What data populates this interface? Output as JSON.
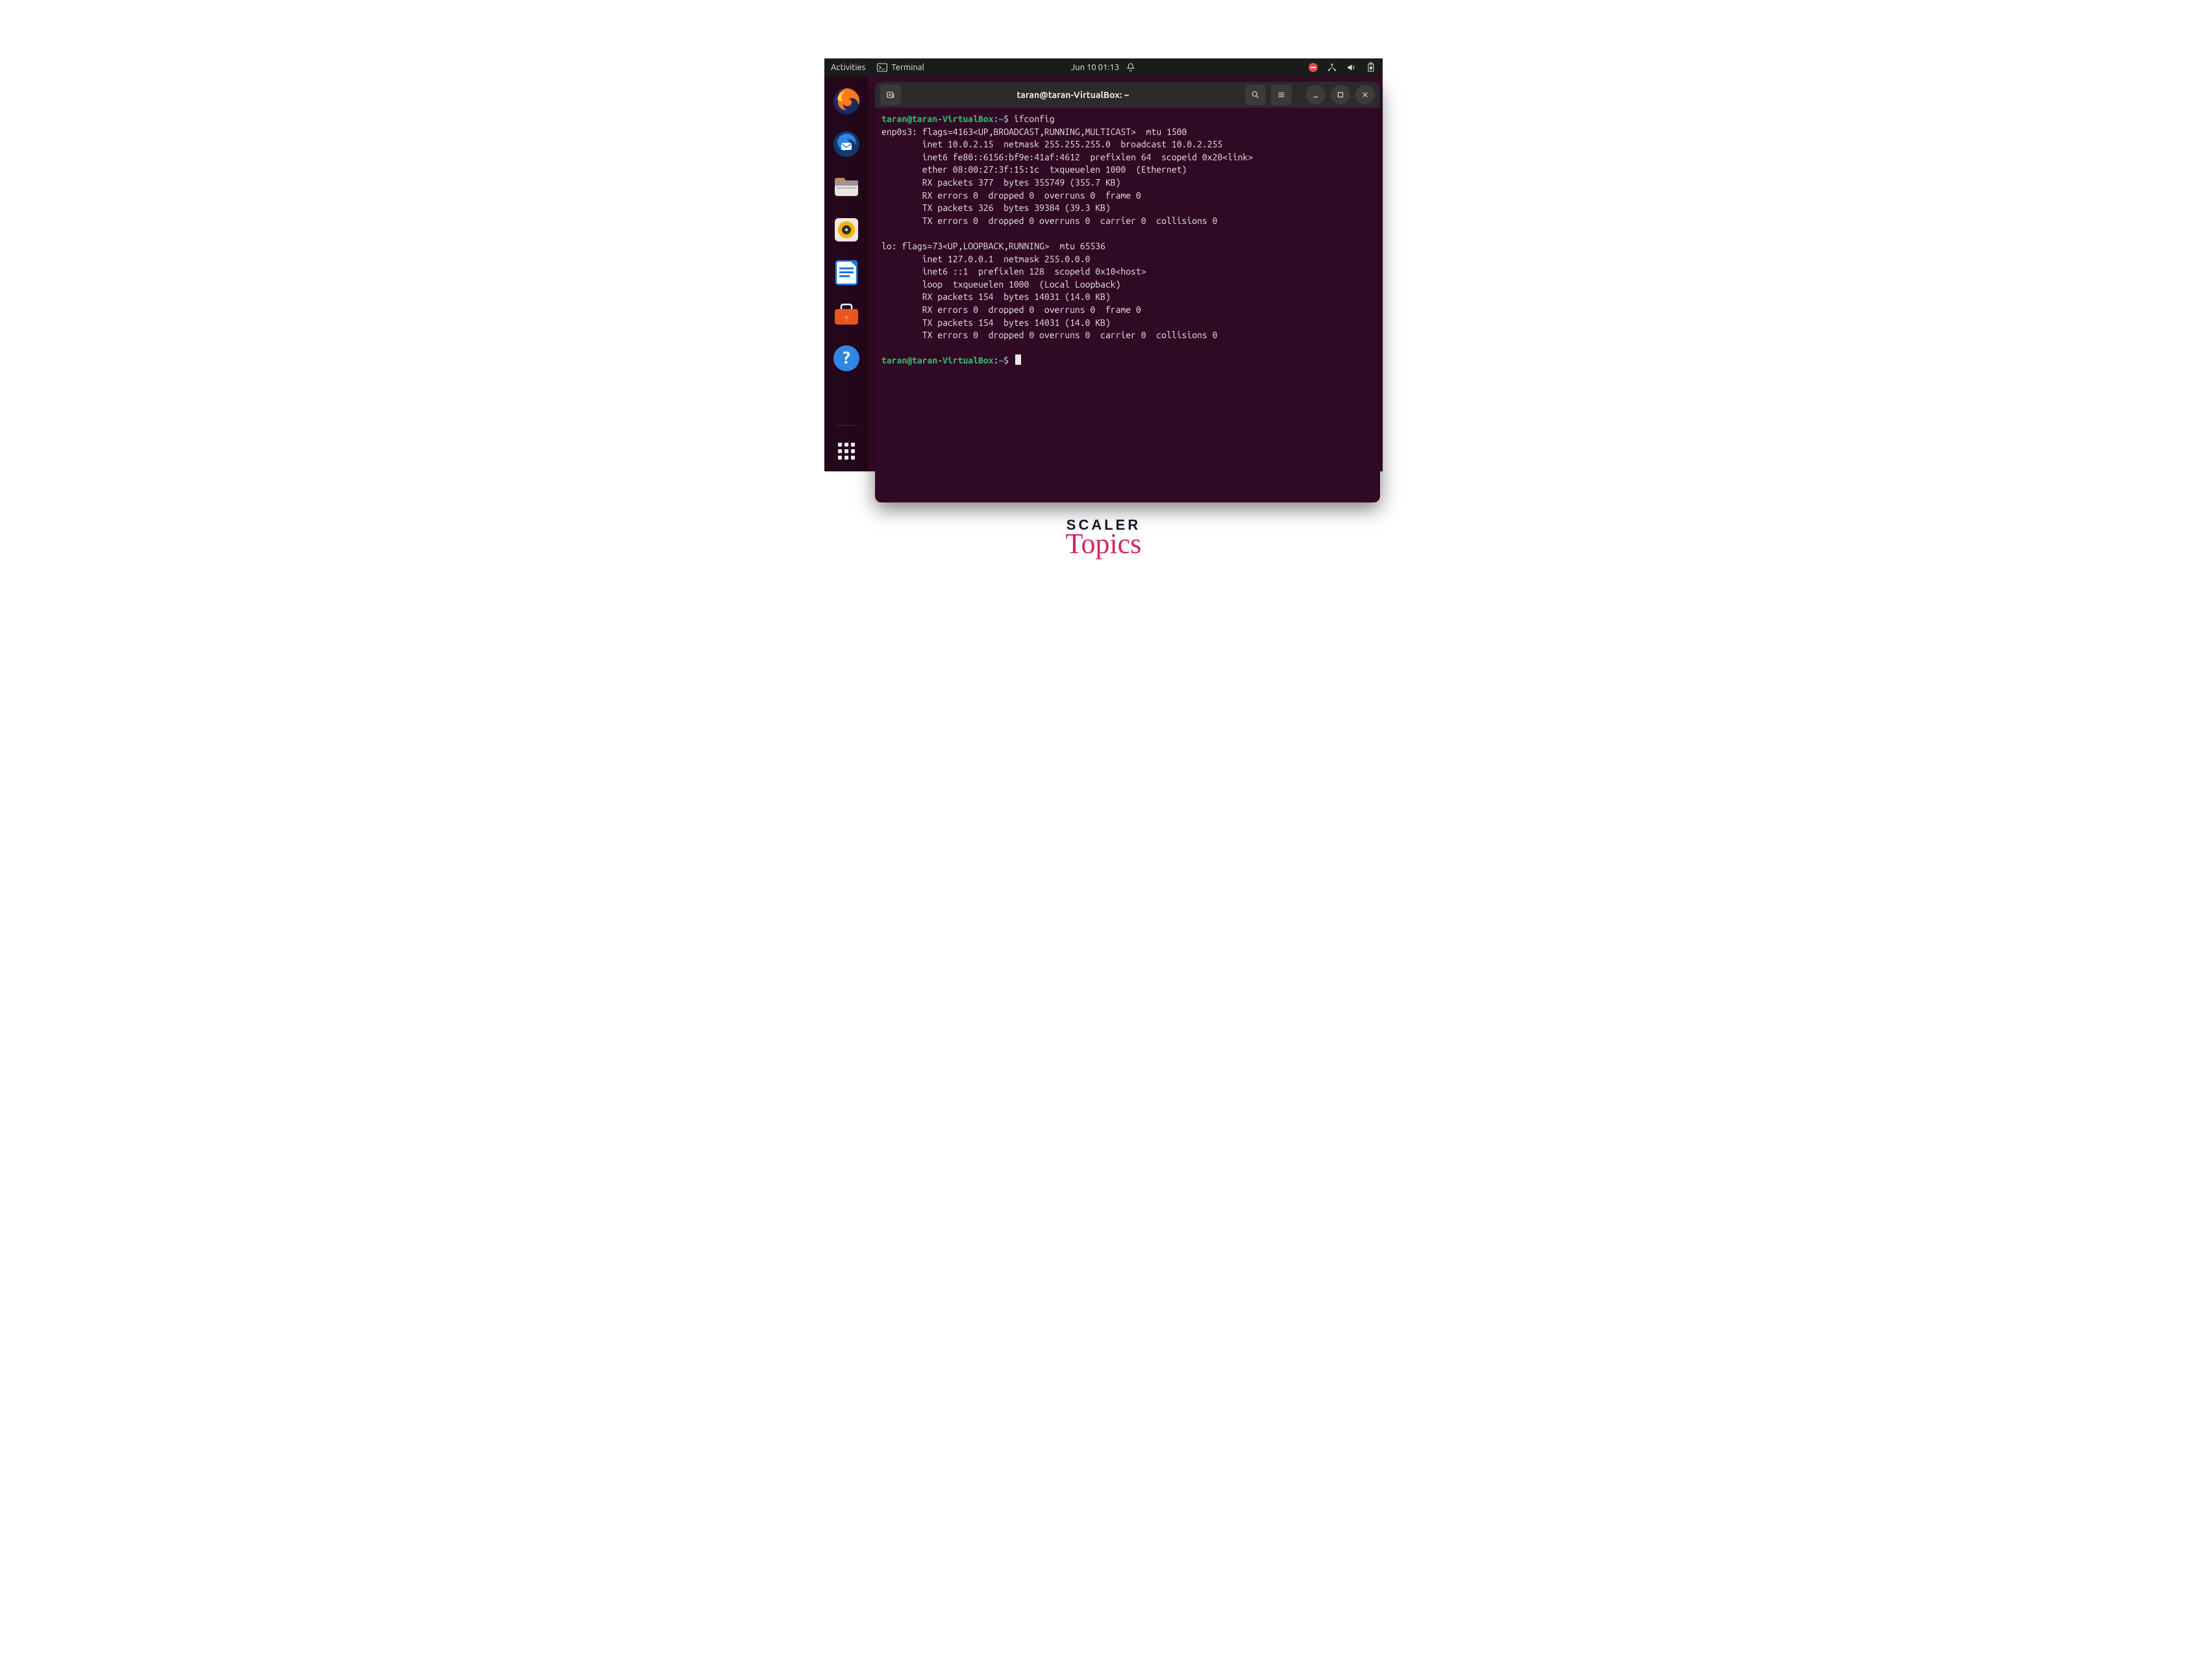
{
  "topbar": {
    "activities": "Activities",
    "app_label": "Terminal",
    "datetime": "Jun 10  01:13"
  },
  "window": {
    "title": "taran@taran-VirtualBox: ~"
  },
  "prompt": {
    "userhost": "taran@taran-VirtualBox",
    "path": "~",
    "command": "ifconfig"
  },
  "output": [
    "enp0s3: flags=4163<UP,BROADCAST,RUNNING,MULTICAST>  mtu 1500",
    "        inet 10.0.2.15  netmask 255.255.255.0  broadcast 10.0.2.255",
    "        inet6 fe80::6156:bf9e:41af:4612  prefixlen 64  scopeid 0x20<link>",
    "        ether 08:00:27:3f:15:1c  txqueuelen 1000  (Ethernet)",
    "        RX packets 377  bytes 355749 (355.7 KB)",
    "        RX errors 0  dropped 0  overruns 0  frame 0",
    "        TX packets 326  bytes 39384 (39.3 KB)",
    "        TX errors 0  dropped 0 overruns 0  carrier 0  collisions 0",
    "",
    "lo: flags=73<UP,LOOPBACK,RUNNING>  mtu 65536",
    "        inet 127.0.0.1  netmask 255.0.0.0",
    "        inet6 ::1  prefixlen 128  scopeid 0x10<host>",
    "        loop  txqueuelen 1000  (Local Loopback)",
    "        RX packets 154  bytes 14031 (14.0 KB)",
    "        RX errors 0  dropped 0  overruns 0  frame 0",
    "        TX packets 154  bytes 14031 (14.0 KB)",
    "        TX errors 0  dropped 0 overruns 0  carrier 0  collisions 0",
    ""
  ],
  "brand": {
    "line1": "SCALER",
    "line2": "Topics"
  }
}
